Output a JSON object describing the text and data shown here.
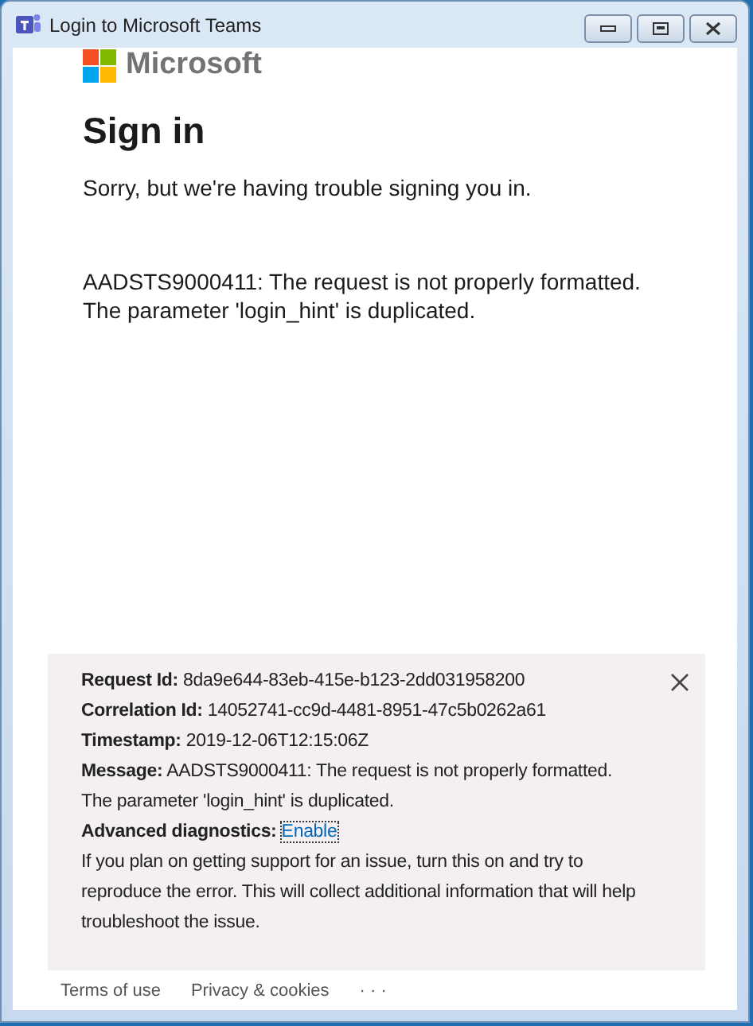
{
  "window": {
    "title": "Login to Microsoft Teams"
  },
  "brand": "Microsoft",
  "heading": "Sign in",
  "subtitle": "Sorry, but we're having trouble signing you in.",
  "error_lines": [
    "AADSTS9000411: The request is not properly formatted.",
    "The parameter 'login_hint' is duplicated."
  ],
  "details": {
    "fields": [
      {
        "label": "Request Id:",
        "value": "8da9e644-83eb-415e-b123-2dd031958200"
      },
      {
        "label": "Correlation Id:",
        "value": "14052741-cc9d-4481-8951-47c5b0262a61"
      },
      {
        "label": "Timestamp:",
        "value": "2019-12-06T12:15:06Z"
      },
      {
        "label": "Message:",
        "value": "AADSTS9000411: The request is not properly formatted.",
        "continuation": "The parameter 'login_hint' is duplicated."
      }
    ],
    "diagnostics": {
      "label": "Advanced diagnostics:",
      "link": "Enable"
    },
    "help": "If you plan on getting support for an issue, turn this on and try to reproduce the error. This will collect additional information that will help troubleshoot the issue."
  },
  "footer": {
    "links": [
      "Terms of use",
      "Privacy & cookies"
    ],
    "more": "· · ·"
  }
}
